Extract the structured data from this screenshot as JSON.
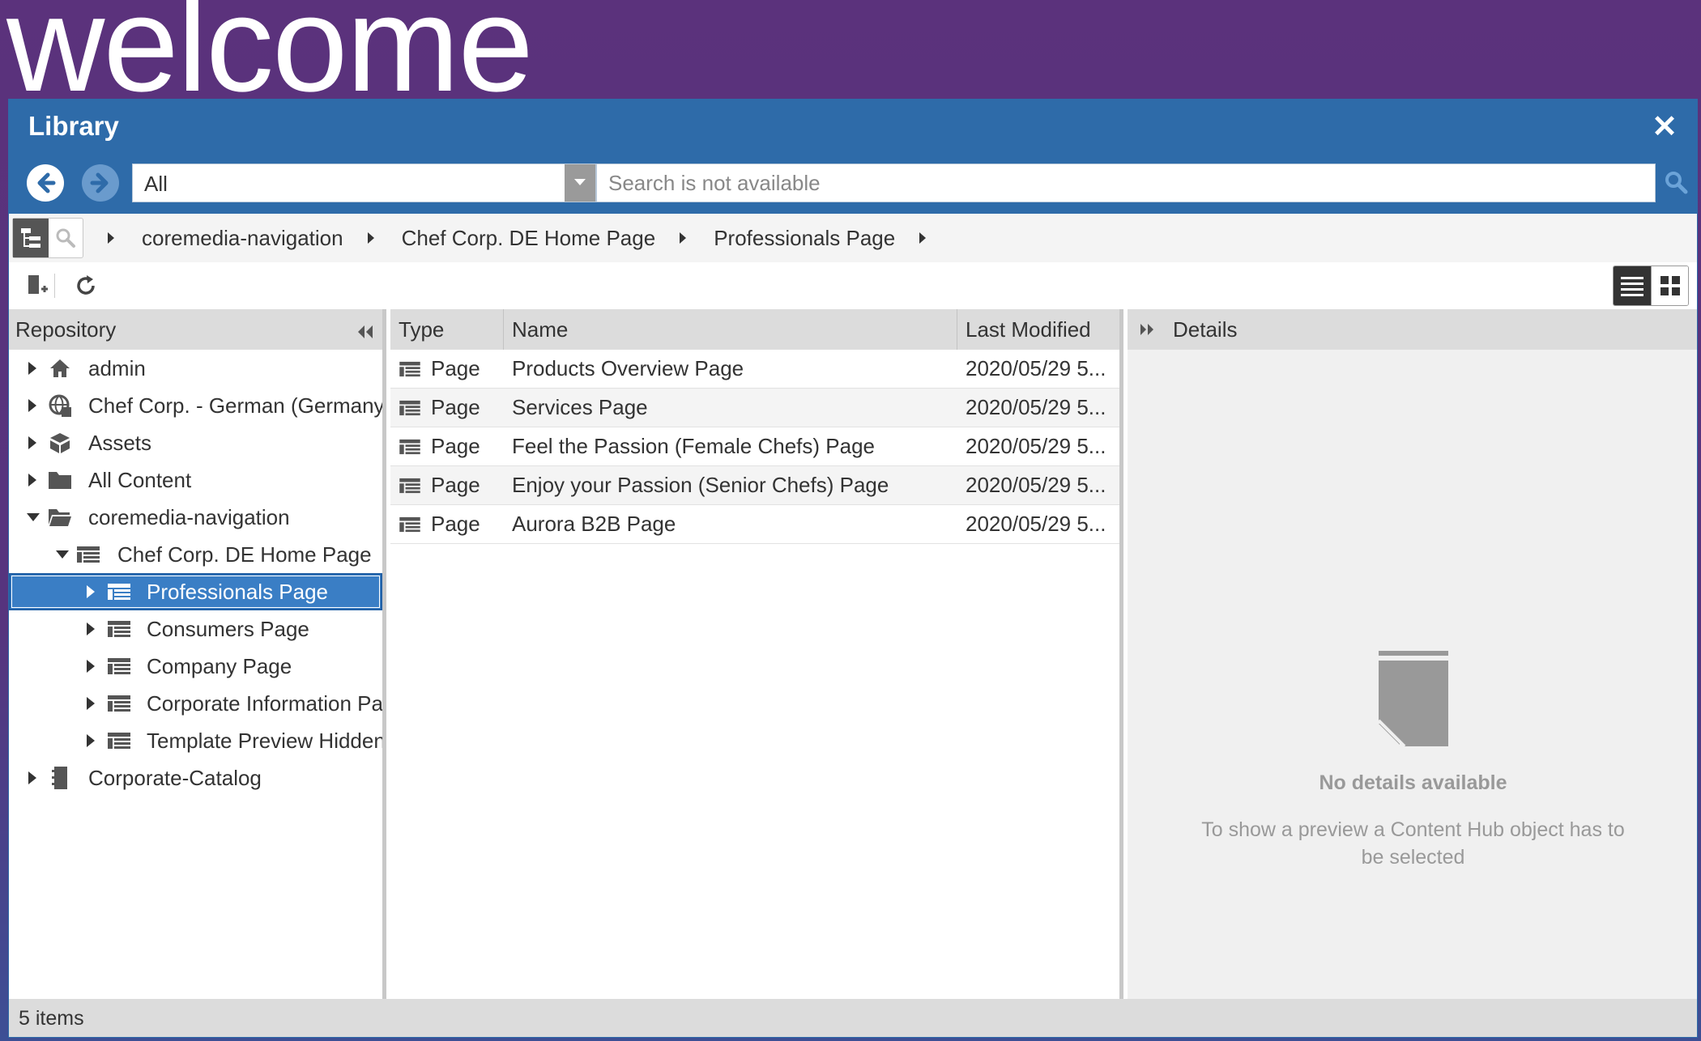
{
  "welcome_text": "welcome",
  "window": {
    "title": "Library",
    "close_label": "✕"
  },
  "search_bar": {
    "type_value": "All",
    "search_placeholder": "Search is not available"
  },
  "breadcrumb": [
    "coremedia-navigation",
    "Chef Corp. DE Home Page",
    "Professionals Page"
  ],
  "repository": {
    "header": "Repository",
    "tree": [
      {
        "label": "admin",
        "icon": "home-icon",
        "expanded": false,
        "selected": false
      },
      {
        "label": "Chef Corp. - German (Germany)",
        "icon": "site-globe-icon",
        "expanded": false,
        "selected": false
      },
      {
        "label": "Assets",
        "icon": "box-icon",
        "expanded": false,
        "selected": false
      },
      {
        "label": "All Content",
        "icon": "folder-icon",
        "expanded": false,
        "selected": false
      },
      {
        "label": "coremedia-navigation",
        "icon": "folder-open-icon",
        "expanded": true,
        "selected": false
      },
      {
        "label": "Chef Corp. DE Home Page",
        "icon": "page-icon",
        "expanded": true,
        "selected": false
      },
      {
        "label": "Professionals Page",
        "icon": "page-icon",
        "expanded": false,
        "selected": true
      },
      {
        "label": "Consumers Page",
        "icon": "page-icon",
        "expanded": false,
        "selected": false
      },
      {
        "label": "Company Page",
        "icon": "page-icon",
        "expanded": false,
        "selected": false
      },
      {
        "label": "Corporate Information Page",
        "icon": "page-icon",
        "expanded": false,
        "selected": false
      },
      {
        "label": "Template Preview Hidden",
        "icon": "page-icon",
        "expanded": false,
        "selected": false
      },
      {
        "label": "Corporate-Catalog",
        "icon": "catalog-icon",
        "expanded": false,
        "selected": false
      }
    ]
  },
  "list": {
    "columns": {
      "type": "Type",
      "name": "Name",
      "modified": "Last Modified"
    },
    "rows": [
      {
        "type": "Page",
        "name": "Products Overview Page",
        "modified": "2020/05/29 5..."
      },
      {
        "type": "Page",
        "name": "Services Page",
        "modified": "2020/05/29 5..."
      },
      {
        "type": "Page",
        "name": "Feel the Passion (Female Chefs) Page",
        "modified": "2020/05/29 5..."
      },
      {
        "type": "Page",
        "name": "Enjoy your Passion (Senior Chefs) Page",
        "modified": "2020/05/29 5..."
      },
      {
        "type": "Page",
        "name": "Aurora B2B Page",
        "modified": "2020/05/29 5..."
      }
    ]
  },
  "details": {
    "header": "Details",
    "empty_title": "No details available",
    "empty_text": "To show a preview a Content Hub object has to be selected"
  },
  "status": {
    "count_text": "5 items"
  },
  "colors": {
    "accent": "#2e6ba9",
    "selection": "#3a7ec5",
    "background": "#5b327c"
  }
}
